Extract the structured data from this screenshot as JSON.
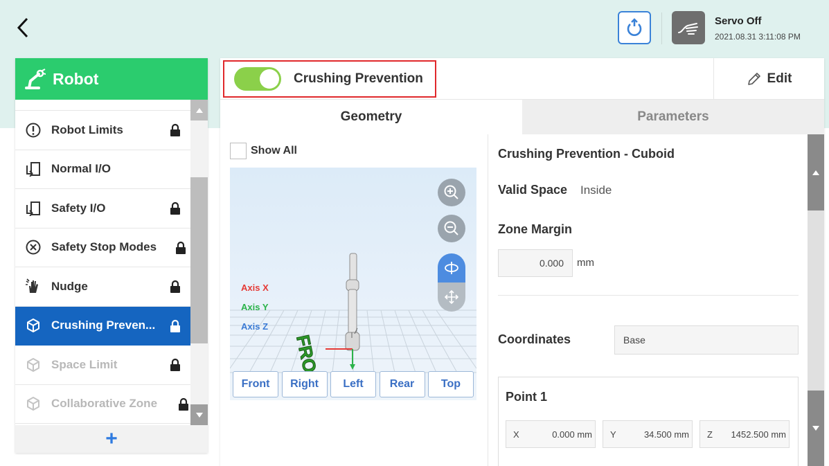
{
  "topbar": {
    "servo_status": "Servo Off",
    "datetime": "2021.08.31 3:11:08 PM"
  },
  "sidebar": {
    "title": "Robot",
    "items": [
      {
        "label": "Robot Limits",
        "icon": "alert-circle-icon",
        "locked": true,
        "state": "normal"
      },
      {
        "label": "Normal I/O",
        "icon": "io-icon",
        "locked": false,
        "state": "normal"
      },
      {
        "label": "Safety I/O",
        "icon": "io-icon",
        "locked": true,
        "state": "normal"
      },
      {
        "label": "Safety Stop Modes",
        "icon": "stop-circle-icon",
        "locked": true,
        "state": "normal"
      },
      {
        "label": "Nudge",
        "icon": "hand-icon",
        "locked": true,
        "state": "normal"
      },
      {
        "label": "Crushing Preven...",
        "icon": "cube-icon",
        "locked": true,
        "state": "active"
      },
      {
        "label": "Space Limit",
        "icon": "cube-icon",
        "locked": true,
        "state": "disabled"
      },
      {
        "label": "Collaborative Zone",
        "icon": "cube-icon",
        "locked": true,
        "state": "disabled"
      }
    ],
    "add_label": "+"
  },
  "header": {
    "feature_label": "Crushing Prevention",
    "feature_enabled": true,
    "edit_label": "Edit"
  },
  "tabs": [
    {
      "label": "Geometry",
      "active": true
    },
    {
      "label": "Parameters",
      "active": false
    }
  ],
  "viewer": {
    "show_all_label": "Show All",
    "axis_x": "Axis X",
    "axis_y": "Axis Y",
    "axis_z": "Axis Z",
    "floor_label": "FRONT",
    "view_buttons": [
      "Front",
      "Right",
      "Left",
      "Rear",
      "Top"
    ],
    "colors": {
      "axis_x": "#e53935",
      "axis_y": "#2bb34a",
      "axis_z": "#3a7bd5"
    }
  },
  "details": {
    "title": "Crushing Prevention - Cuboid",
    "valid_space_label": "Valid Space",
    "valid_space_value": "Inside",
    "zone_margin_label": "Zone Margin",
    "zone_margin_value": "0.000",
    "zone_margin_unit": "mm",
    "coordinates_label": "Coordinates",
    "coordinates_value": "Base",
    "point": {
      "title": "Point 1",
      "x_label": "X",
      "x_value": "0.000 mm",
      "y_label": "Y",
      "y_value": "34.500 mm",
      "z_label": "Z",
      "z_value": "1452.500 mm"
    }
  }
}
